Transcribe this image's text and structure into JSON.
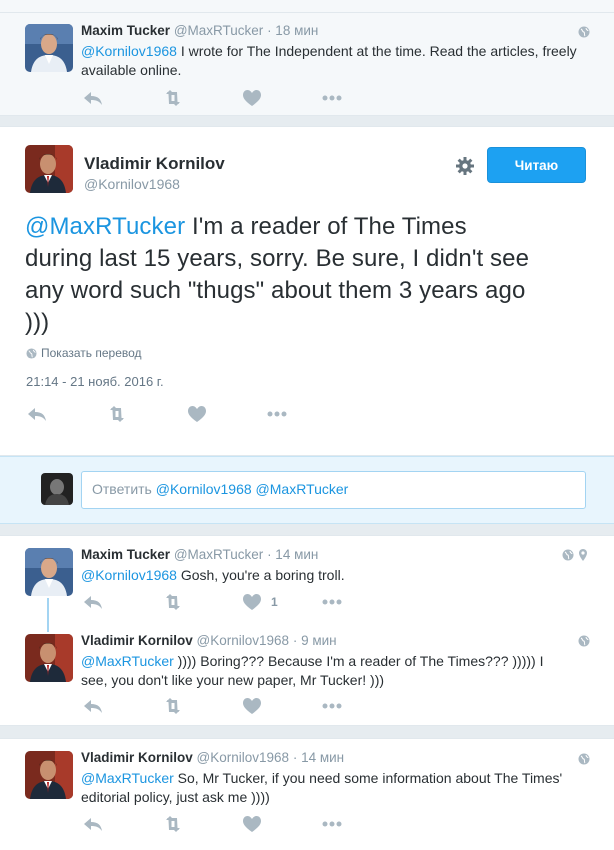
{
  "tweets_top": {
    "author_name": "Maxim Tucker",
    "author_handle": "@MaxRTucker",
    "time": "· 18 мин",
    "mention": "@Kornilov1968",
    "text_line1_rest": " I wrote for The Independent at the time. Read the articles, freely",
    "text_line2": "available online."
  },
  "main_tweet": {
    "author_name": "Vladimir Kornilov",
    "author_handle": "@Kornilov1968",
    "follow_label": "Читаю",
    "mention": "@MaxRTucker",
    "text_line1_rest": " I'm a reader of The Times",
    "text_line2": "during last 15 years, sorry. Be sure, I didn't see",
    "text_line3": "any word such \"thugs\" about them 3 years ago",
    "text_line4": ")))",
    "translate_label": "Показать перевод",
    "timestamp": "21:14 - 21 нояб. 2016 г."
  },
  "reply_box": {
    "placeholder_prefix": "Ответить ",
    "placeholder_mentions": "@Kornilov1968 @MaxRTucker"
  },
  "replies": [
    {
      "author_name": "Maxim Tucker",
      "author_handle": "@MaxRTucker",
      "time": "· 14 мин",
      "mention": "@Kornilov1968",
      "text_line1_rest": " Gosh, you're a boring troll.",
      "like_count": "1"
    },
    {
      "author_name": "Vladimir Kornilov",
      "author_handle": "@Kornilov1968",
      "time": "· 9 мин",
      "mention": "@MaxRTucker",
      "text_line1_rest": " )))) Boring???  Because I'm a reader of The Times??? ))))) I",
      "text_line2": "see, you don't like your new paper, Mr Tucker! )))"
    },
    {
      "author_name": "Vladimir Kornilov",
      "author_handle": "@Kornilov1968",
      "time": "· 14 мин",
      "mention": "@MaxRTucker",
      "text_line1_rest": " So, Mr Tucker, if you need some information about The Times'",
      "text_line2": "editorial policy, just ask me ))))"
    }
  ],
  "colors": {
    "accent": "#1da1f2",
    "mention": "#1b95e0",
    "muted": "#8899a6"
  },
  "icons": [
    "reply-icon",
    "retweet-icon",
    "like-icon",
    "more-icon",
    "globe-icon",
    "gear-icon",
    "location-icon"
  ]
}
